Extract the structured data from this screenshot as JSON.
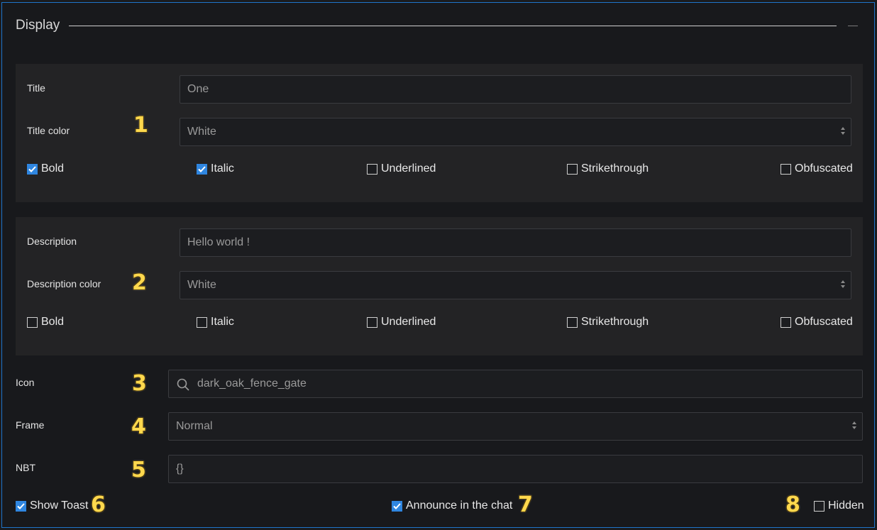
{
  "section": {
    "title": "Display"
  },
  "title_card": {
    "title_label": "Title",
    "title_value": "One",
    "color_label": "Title color",
    "color_value": "White",
    "badge": "1",
    "options": [
      {
        "label": "Bold",
        "checked": true
      },
      {
        "label": "Italic",
        "checked": true
      },
      {
        "label": "Underlined",
        "checked": false
      },
      {
        "label": "Strikethrough",
        "checked": false
      },
      {
        "label": "Obfuscated",
        "checked": false
      }
    ]
  },
  "description_card": {
    "desc_label": "Description",
    "desc_value": "Hello world !",
    "color_label": "Description color",
    "color_value": "White",
    "badge": "2",
    "options": [
      {
        "label": "Bold",
        "checked": false
      },
      {
        "label": "Italic",
        "checked": false
      },
      {
        "label": "Underlined",
        "checked": false
      },
      {
        "label": "Strikethrough",
        "checked": false
      },
      {
        "label": "Obfuscated",
        "checked": false
      }
    ]
  },
  "icon": {
    "label": "Icon",
    "value": "dark_oak_fence_gate",
    "badge": "3",
    "icon_name": "search-icon"
  },
  "frame": {
    "label": "Frame",
    "value": "Normal",
    "badge": "4"
  },
  "nbt": {
    "label": "NBT",
    "value": "{}",
    "badge": "5"
  },
  "footer": {
    "show_toast": {
      "label": "Show Toast",
      "checked": true,
      "badge": "6"
    },
    "announce": {
      "label": "Announce in the chat",
      "checked": true,
      "badge": "7"
    },
    "hidden": {
      "label": "Hidden",
      "checked": false,
      "badge": "8"
    }
  },
  "colors": {
    "accent": "#2f86e0",
    "border": "#1f74c9",
    "badge": "#ffd84d"
  }
}
